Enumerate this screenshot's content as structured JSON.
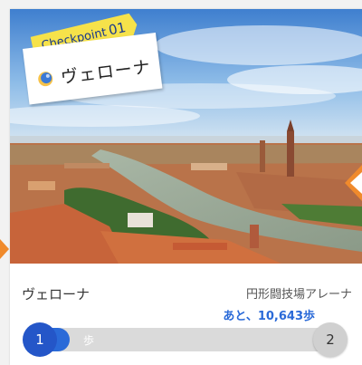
{
  "checkpoint": {
    "label": "Checkpoint",
    "number": "01",
    "city": "ヴェローナ"
  },
  "route": {
    "start_name": "ヴェローナ",
    "destination_name": "円形闘技場アレーナ",
    "remaining_text": "あと、10,643歩"
  },
  "progress": {
    "start_number": "1",
    "end_number": "2",
    "unit_label": "歩",
    "fraction": 0.1
  },
  "colors": {
    "accent_blue": "#2a6ad8",
    "ribbon_yellow": "#f6e24a",
    "arrow_orange": "#f08a2c"
  },
  "icons": {
    "city": "globe-icon",
    "next": "next-arrow-icon",
    "prev": "prev-arrow-icon"
  }
}
